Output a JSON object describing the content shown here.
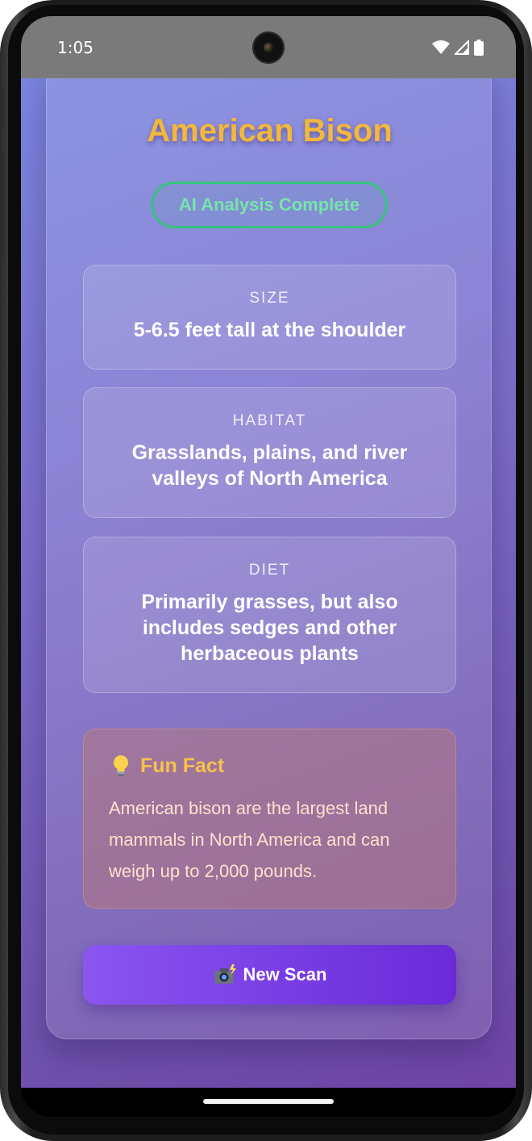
{
  "status_bar": {
    "time": "1:05",
    "icons": [
      "wifi-icon",
      "cellular-icon",
      "battery-icon"
    ]
  },
  "result": {
    "animal_name": "American Bison",
    "status_badge": "AI Analysis Complete",
    "details": [
      {
        "label": "SIZE",
        "value": "5-6.5 feet tall at the shoulder"
      },
      {
        "label": "HABITAT",
        "value": "Grasslands, plains, and river valleys of North America"
      },
      {
        "label": "DIET",
        "value": "Primarily grasses, but also includes sedges and other herbaceous plants"
      }
    ],
    "fun_fact": {
      "icon": "lightbulb-icon",
      "title": "Fun Fact",
      "text": "American bison are the largest land mammals in North America and can weigh up to 2,000 pounds."
    }
  },
  "actions": {
    "new_scan_icon": "camera-flash-icon",
    "new_scan_label": "New Scan"
  },
  "colors": {
    "title": "#f4b73a",
    "badge_border": "#34c47c",
    "badge_text": "#74e6a8",
    "fun_fact_title": "#f6c24a",
    "button_start": "#8a55f0",
    "button_end": "#6a2ad8"
  }
}
